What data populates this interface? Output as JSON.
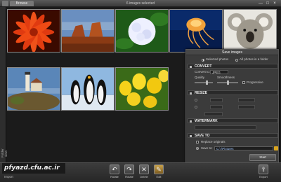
{
  "titlebar": {
    "tab": "Browse",
    "title": "6 images selected",
    "controls": [
      "—",
      "□",
      "×"
    ]
  },
  "sidebar": {
    "label": "Folder view"
  },
  "thumbnails": [
    {
      "name": "orange-flower"
    },
    {
      "name": "desert-rock"
    },
    {
      "name": "white-hydrangea"
    },
    {
      "name": "jellyfish"
    },
    {
      "name": "koala"
    },
    {
      "name": "lighthouse"
    },
    {
      "name": "penguins"
    },
    {
      "name": "tulips"
    }
  ],
  "save_panel": {
    "title": "Save images",
    "selection": {
      "option_selected": "Selected photos",
      "option_all": "All photos in a folder"
    },
    "convert": {
      "header": "CONVERT",
      "convert_to_label": "Convert to:",
      "format": "JPEG",
      "quality_label": "Quality",
      "smoothness_label": "Smoothness",
      "progressive_label": "Progressive"
    },
    "resize": {
      "header": "RESIZE"
    },
    "watermark": {
      "header": "WATERMARK"
    },
    "save_to": {
      "header": "SAVE TO",
      "replace_label": "Replace originals",
      "save_to_label": "Save to:",
      "path": "C:\\            \\Pictures",
      "start_label": "Start"
    }
  },
  "toolbar": {
    "rotate_left": "Rotate",
    "rotate_right": "Rotate",
    "delete": "Delete",
    "edit": "Edit",
    "export": "Export"
  },
  "watermark_text": "pfyazd.cfu.ac.ir",
  "import_label": "Import"
}
